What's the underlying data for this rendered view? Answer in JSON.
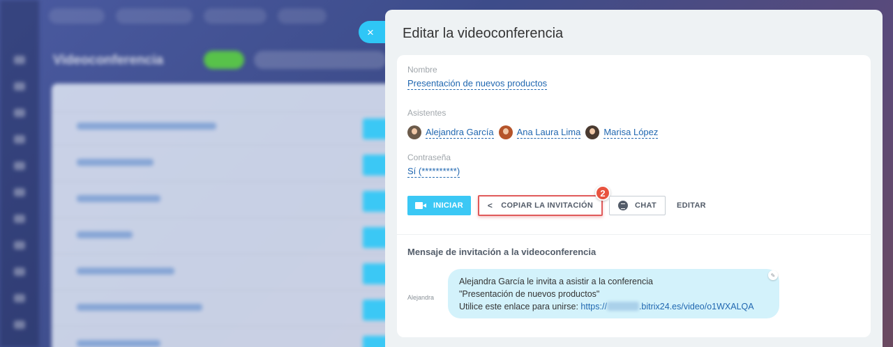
{
  "background": {
    "page_title": "Videoconferencia"
  },
  "panel": {
    "close_icon": "×",
    "title": "Editar la videoconferencia"
  },
  "form": {
    "name_label": "Nombre",
    "name_value": "Presentación de nuevos productos",
    "attendees_label": "Asistentes",
    "attendees": [
      {
        "name": "Alejandra García"
      },
      {
        "name": "Ana Laura Lima"
      },
      {
        "name": "Marisa López"
      }
    ],
    "password_label": "Contraseña",
    "password_value": "Sí (**********)"
  },
  "buttons": {
    "start_label": "INICIAR",
    "copy_label": "COPIAR LA INVITACIÓN",
    "copy_badge": "2",
    "chat_label": "CHAT",
    "edit_label": "EDITAR"
  },
  "invitation": {
    "section_title": "Mensaje de invitación a la videoconferencia",
    "sender": "Alejandra",
    "line1": "Alejandra García le invita a asistir a la conferencia",
    "line2": "\"Presentación de nuevos productos\"",
    "line3_prefix": "Utilice este enlace para unirse: ",
    "link_start": "https://",
    "link_end": ".bitrix24.es/video/o1WXALQA"
  },
  "colors": {
    "accent": "#2fc6f6",
    "link": "#2067b0",
    "highlight": "#e05a5a",
    "bubble": "#d3f2fb"
  }
}
